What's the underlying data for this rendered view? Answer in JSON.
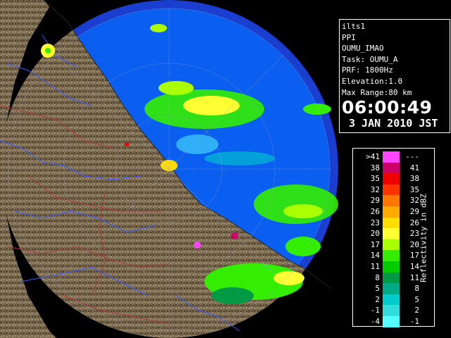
{
  "info": {
    "radar_name": "ilts1",
    "product": "PPI",
    "site": "OUMU_IMAO",
    "task": "Task: OUMU_A",
    "prf": "PRF: 1800Hz",
    "elevation": "Elevation:1.0",
    "max_range": "Max Range:80 km",
    "time": "06:00:49",
    "date": "3 JAN 2010 JST"
  },
  "legend": {
    "label": "Reflectivity in dBZ",
    "rows": [
      {
        "lo": ">41",
        "hi": "---",
        "color": "#ff44ff"
      },
      {
        "lo": "38",
        "hi": "41",
        "color": "#cc0066"
      },
      {
        "lo": "35",
        "hi": "38",
        "color": "#ee0000"
      },
      {
        "lo": "32",
        "hi": "35",
        "color": "#ff3300"
      },
      {
        "lo": "29",
        "hi": "32",
        "color": "#ff7700"
      },
      {
        "lo": "26",
        "hi": "29",
        "color": "#ffaa00"
      },
      {
        "lo": "23",
        "hi": "26",
        "color": "#ffdd00"
      },
      {
        "lo": "20",
        "hi": "23",
        "color": "#ffff33"
      },
      {
        "lo": "17",
        "hi": "20",
        "color": "#aaff00"
      },
      {
        "lo": "14",
        "hi": "17",
        "color": "#33ee00"
      },
      {
        "lo": "11",
        "hi": "14",
        "color": "#00cc00"
      },
      {
        "lo": "8",
        "hi": "11",
        "color": "#009944"
      },
      {
        "lo": "5",
        "hi": "8",
        "color": "#00aa88"
      },
      {
        "lo": "2",
        "hi": "5",
        "color": "#00cccc"
      },
      {
        "lo": "-1",
        "hi": "2",
        "color": "#33dddd"
      },
      {
        "lo": "-4",
        "hi": "-1",
        "color": "#55ffff"
      }
    ]
  },
  "colors": {
    "sea": "#0a5ff0",
    "outer": "#1a3fd0",
    "land": "#7a6a50",
    "range_ring": "#a0a8c0"
  }
}
